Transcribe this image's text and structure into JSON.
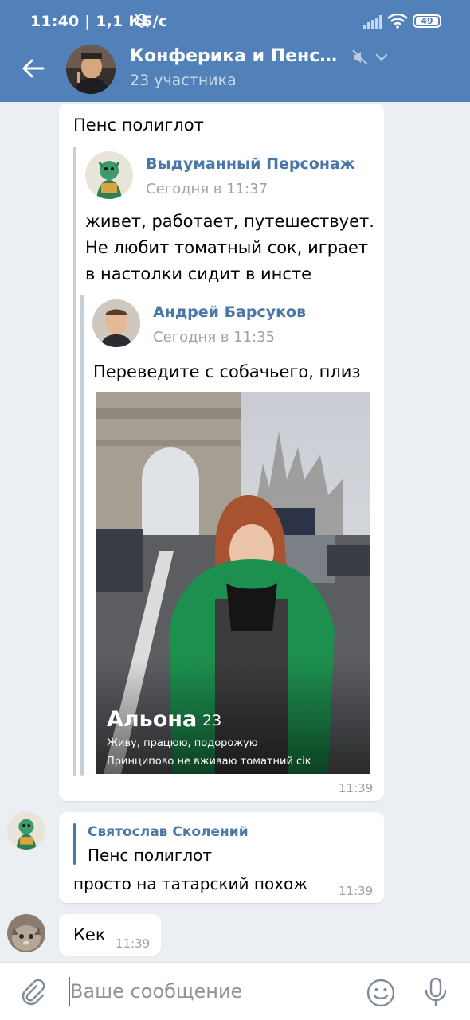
{
  "status_bar": {
    "time": "11:40 | 1,1 КБ/с",
    "battery": "49"
  },
  "header": {
    "title": "Конферика и Пенсори...",
    "subtitle": "23 участника"
  },
  "messages": [
    {
      "text": "Пенс полиглот",
      "time": "11:39",
      "forwarded": {
        "author": "Выдуманный Персонаж",
        "date": "Сегодня в 11:37",
        "text_lines": [
          "живет, работает, путешествует.",
          "Не любит томатный сок, играет",
          "в настолки сидит в инсте"
        ],
        "forwarded": {
          "author": "Андрей Барсуков",
          "date": "Сегодня в 11:35",
          "text": "Переведите с собачьего, плиз",
          "photo": {
            "name": "Альона",
            "age": "23",
            "line1": "Живу, працюю, подорожую",
            "line2": "Принципово не вживаю томатний сік"
          }
        }
      }
    },
    {
      "reply_author": "Святослав Сколений",
      "reply_text": "Пенс полиглот",
      "text": "просто на татарский похож",
      "time": "11:39"
    },
    {
      "text": "Кек",
      "time": "11:39"
    }
  ],
  "composer": {
    "placeholder": "Ваше сообщение"
  }
}
